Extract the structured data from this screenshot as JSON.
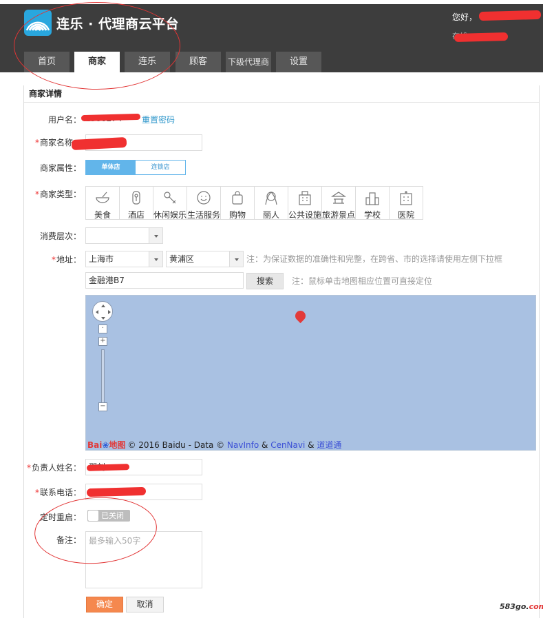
{
  "header": {
    "brand": "连乐 · 代理商云平台",
    "greeting": "您好，",
    "sub_text": "在线",
    "tabs": [
      {
        "label": "首页"
      },
      {
        "label": "商家"
      },
      {
        "label": "连乐"
      },
      {
        "label": "顾客"
      },
      {
        "label": "下级代理商"
      },
      {
        "label": "设置"
      }
    ],
    "active_tab": 1
  },
  "panel": {
    "title": "商家详情",
    "username_label": "用户名：",
    "username_value": "1386274",
    "reset_password": "重置密码",
    "name_label": "商家名称：",
    "attr_label": "商家属性：",
    "attr_options": [
      "单体店",
      "连锁店"
    ],
    "type_label": "商家类型：",
    "types": [
      {
        "label": "美食",
        "icon": "bowl-icon"
      },
      {
        "label": "酒店",
        "icon": "hotel-icon"
      },
      {
        "label": "休闲娱乐",
        "icon": "leisure-icon"
      },
      {
        "label": "生活服务",
        "icon": "smile-icon"
      },
      {
        "label": "购物",
        "icon": "bag-icon"
      },
      {
        "label": "丽人",
        "icon": "beauty-icon"
      },
      {
        "label": "公共设施",
        "icon": "building-icon"
      },
      {
        "label": "旅游景点",
        "icon": "temple-icon"
      },
      {
        "label": "学校",
        "icon": "school-icon"
      },
      {
        "label": "医院",
        "icon": "hospital-icon"
      }
    ],
    "consume_label": "消费层次：",
    "consume_value": "",
    "address_label": "地址：",
    "city_value": "上海市",
    "district_value": "黄浦区",
    "address_note": "注：为保证数据的准确性和完整，在跨省、市的选择请使用左侧下拉框",
    "street_value": "金融港B7",
    "search_button": "搜索",
    "map_note": "注：鼠标单击地图相应位置可直接定位",
    "map_copyright": "© 2016 Baidu - Data ©",
    "map_link_1": "NavInfo",
    "map_amp": "&",
    "map_link_2": "CenNavi",
    "map_link_3": "道道通",
    "baidu_logo": "Bai",
    "baidu_logo_2": "地图",
    "owner_label": "负责人姓名：",
    "owner_value": "邵刘",
    "phone_label": "联系电话：",
    "phone_value": "1881",
    "reboot_label": "定时重启：",
    "reboot_state": "已关闭",
    "remark_label": "备注：",
    "remark_placeholder": "最多输入50字",
    "ok_button": "确定",
    "cancel_button": "取消"
  },
  "watermark": {
    "a": "583go.",
    "b": "com"
  },
  "colors": {
    "header_bg": "#3d3d3d",
    "accent_blue": "#62b5ea",
    "ok_orange": "#f5884e",
    "required_red": "#e33333",
    "map_bg": "#a9c1e2"
  }
}
